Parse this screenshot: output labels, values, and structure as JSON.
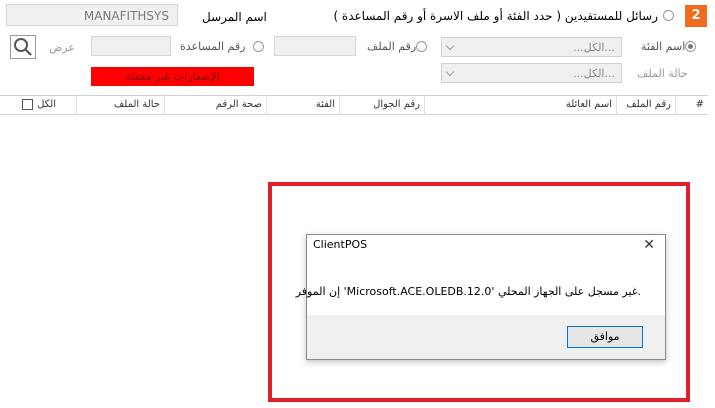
{
  "header": {
    "step_number": "2",
    "option_label": "رسائل للمستفيدين ( حدد الفئة أو ملف الاسرة أو رقم المساعدة )",
    "sender_label": "اسم المرسل",
    "sender_value": "MANAFITHSYS"
  },
  "filters": {
    "category_label": "اسم الفئة",
    "category_value": "...الكل...",
    "file_number_label": "رقم الملف",
    "file_number_value": "",
    "assistance_number_label": "رقم المساعدة",
    "assistance_number_value": "",
    "view_label": "عرض",
    "file_status_label": "حالة الملف",
    "file_status_value": "...الكل...",
    "notice": "الإشعارات غير مفعلة"
  },
  "table": {
    "columns": [
      "#",
      "رقم الملف",
      "اسم العائلة",
      "رقم الجوال",
      "الفئة",
      "صحة الرقم",
      "حالة الملف",
      "الكل"
    ]
  },
  "dialog": {
    "title": "ClientPOS",
    "message": ".غير مسجل على الجهاز المحلي 'Microsoft.ACE.OLEDB.12.0' إن الموفر",
    "ok_label": "موافق",
    "close_symbol": "✕"
  },
  "colors": {
    "step_badge": "#f26a1b",
    "notice_bg": "#ff0000",
    "highlight_frame": "#e0202a"
  }
}
